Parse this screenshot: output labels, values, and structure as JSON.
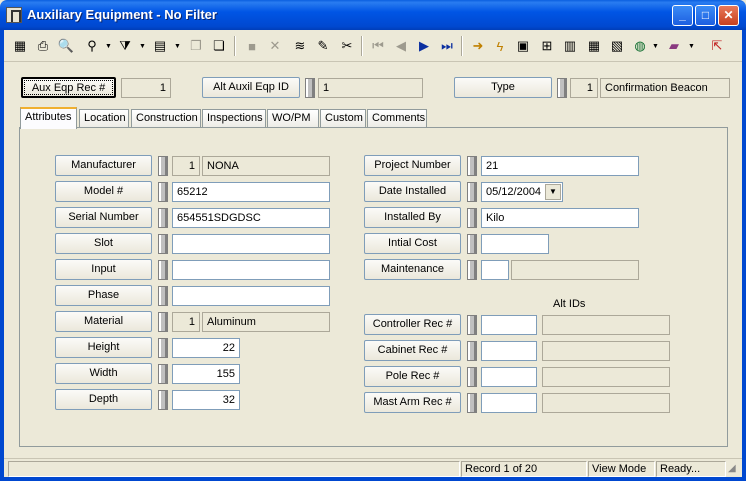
{
  "window": {
    "title": "Auxiliary Equipment - No Filter",
    "minimize": "_",
    "maximize": "□",
    "close": "✕"
  },
  "toolbar": {
    "icons": [
      "save-icon",
      "print-icon",
      "preview-icon",
      "find-icon",
      "filter-icon",
      "report-icon",
      "copy-icon",
      "copy2-icon",
      "disabled-icon",
      "delete-icon",
      "spell-icon",
      "edit-icon",
      "cut-icon",
      "first-icon",
      "prev-icon",
      "next-icon",
      "last-icon",
      "arrow-icon",
      "flash-icon",
      "map-icon",
      "tree-icon",
      "chart-icon",
      "calc-icon",
      "image-icon",
      "globe-icon",
      "book-icon",
      "exit-icon"
    ]
  },
  "header": {
    "aux_eqp_rec_label": "Aux Eqp Rec #",
    "aux_eqp_rec_value": "1",
    "alt_auxil_label": "Alt Auxil Eqp  ID",
    "alt_auxil_value": "1",
    "type_label": "Type",
    "type_code": "1",
    "type_value": "Confirmation Beacon"
  },
  "tabs": [
    "Attributes",
    "Location",
    "Construction",
    "Inspections",
    "WO/PM",
    "Custom",
    "Comments"
  ],
  "left": {
    "manufacturer_label": "Manufacturer",
    "manufacturer_code": "1",
    "manufacturer_value": "NONA",
    "model_label": "Model #",
    "model_value": "65212",
    "serial_label": "Serial Number",
    "serial_value": "654551SDGDSC",
    "slot_label": "Slot",
    "slot_value": "",
    "input_label": "Input",
    "input_value": "",
    "phase_label": "Phase",
    "phase_value": "",
    "material_label": "Material",
    "material_code": "1",
    "material_value": "Aluminum",
    "height_label": "Height",
    "height_value": "22",
    "width_label": "Width",
    "width_value": "155",
    "depth_label": "Depth",
    "depth_value": "32"
  },
  "right": {
    "project_label": "Project Number",
    "project_value": "21",
    "date_label": "Date Installed",
    "date_value": "05/12/2004",
    "installed_by_label": "Installed By",
    "installed_by_value": "Kilo",
    "cost_label": "Intial Cost",
    "cost_value": "",
    "maintenance_label": "Maintenance",
    "maintenance_code": "",
    "maintenance_value": "",
    "alt_ids_title": "Alt IDs",
    "controller_label": "Controller Rec #",
    "controller_value": "",
    "controller_alt": "",
    "cabinet_label": "Cabinet Rec #",
    "cabinet_value": "",
    "cabinet_alt": "",
    "pole_label": "Pole Rec #",
    "pole_value": "",
    "pole_alt": "",
    "mast_label": "Mast Arm Rec #",
    "mast_value": "",
    "mast_alt": ""
  },
  "status": {
    "record": "Record 1 of 20",
    "mode": "View Mode",
    "state": "Ready..."
  }
}
